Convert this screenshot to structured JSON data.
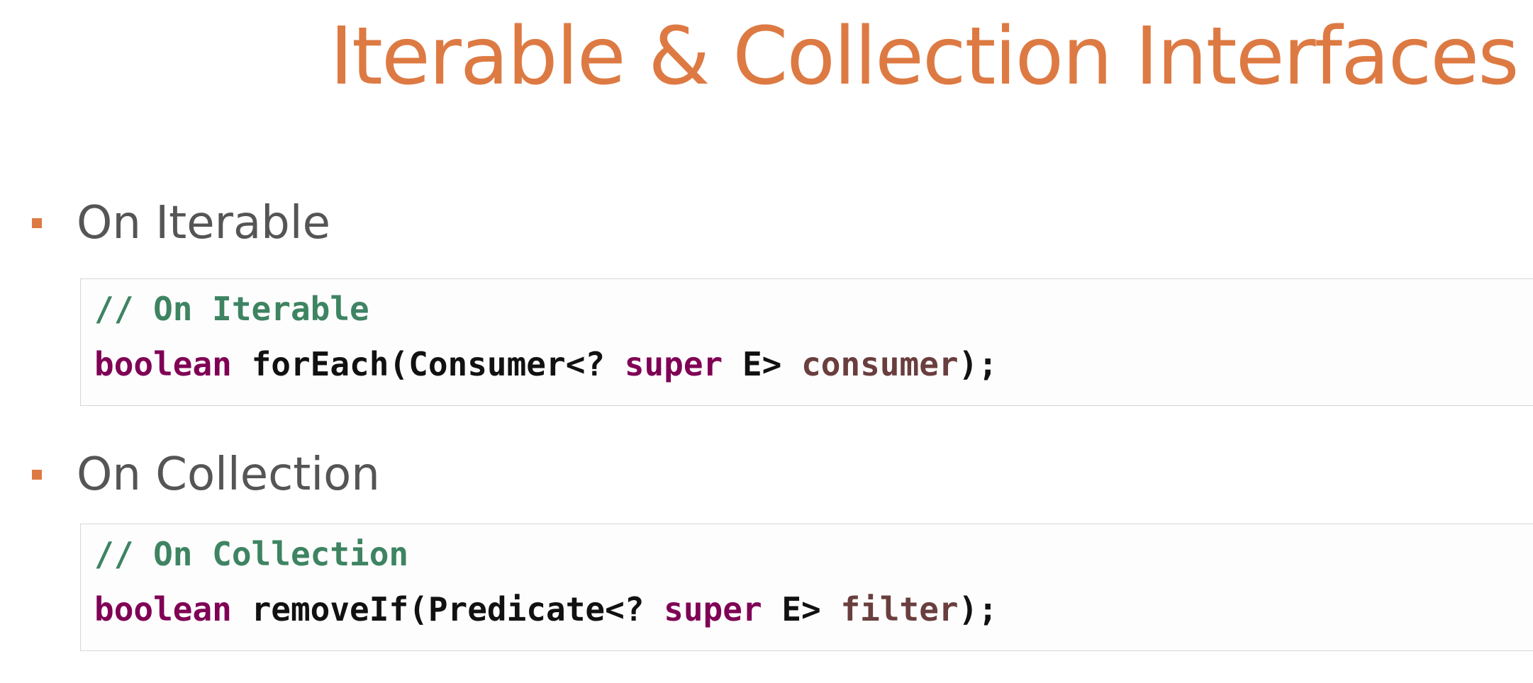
{
  "slide": {
    "title": "Iterable & Collection Interfaces"
  },
  "sections": [
    {
      "bullet": "On Iterable",
      "code": {
        "comment": "// On Iterable",
        "return_type": "boolean",
        "method_open": "forEach(Consumer<?",
        "super_kw": "super",
        "type_close": "E>",
        "param": "consumer",
        "tail": ");"
      }
    },
    {
      "bullet": "On Collection",
      "code": {
        "comment": "// On Collection",
        "return_type": "boolean",
        "method_open": "removeIf(Predicate<?",
        "super_kw": "super",
        "type_close": "E>",
        "param": "filter",
        "tail": ");"
      }
    }
  ],
  "colors": {
    "accent": "#DD7A43",
    "bullet_text": "#555555",
    "comment": "#3E8462",
    "keyword": "#7F0055",
    "parameter": "#6A3E3E"
  }
}
